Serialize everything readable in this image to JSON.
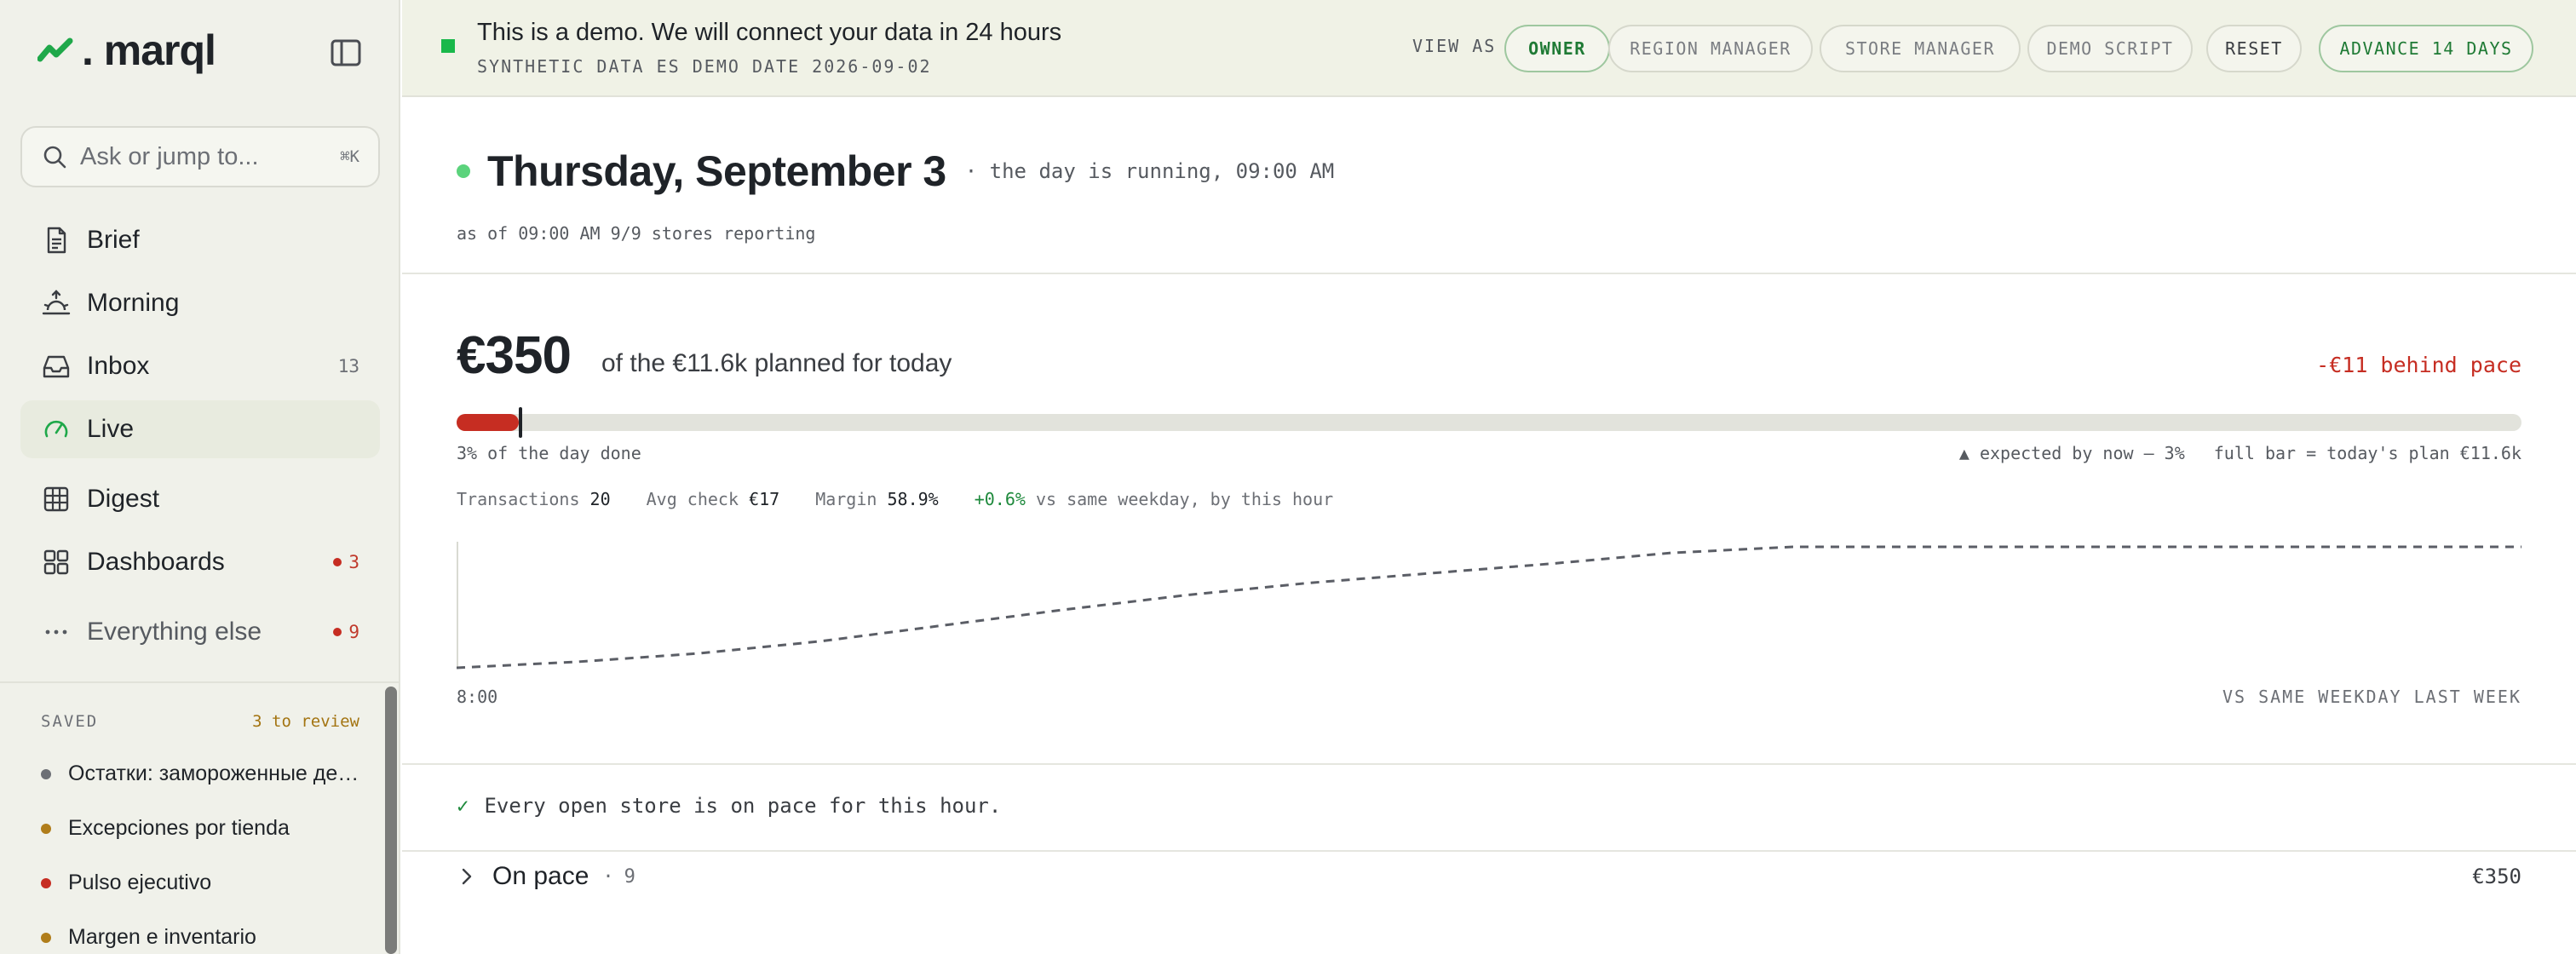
{
  "app": {
    "logo_text": ". marql"
  },
  "search": {
    "placeholder": "Ask or jump to...",
    "shortcut": "⌘K"
  },
  "nav": {
    "brief": "Brief",
    "morning": "Morning",
    "inbox": {
      "label": "Inbox",
      "count": "13"
    },
    "live": "Live",
    "digest": "Digest",
    "dashboards": {
      "label": "Dashboards",
      "badge": "3"
    },
    "everything_else": {
      "label": "Everything else",
      "badge": "9"
    }
  },
  "saved": {
    "title": "SAVED",
    "review": "3 to review",
    "items": [
      {
        "label": "Остатки: замороженные ден...",
        "color": "#6c6f75"
      },
      {
        "label": "Excepciones por tienda",
        "color": "#b07d1a"
      },
      {
        "label": "Pulso ejecutivo",
        "color": "#c62d22"
      },
      {
        "label": "Margen e inventario",
        "color": "#b07d1a"
      }
    ]
  },
  "banner": {
    "message": "This is a demo. We will connect your data in 24 hours",
    "meta": "SYNTHETIC DATA  ES  DEMO DATE 2026-09-02",
    "view_as": "VIEW AS",
    "buttons": {
      "owner": "OWNER",
      "region_manager": "REGION MANAGER",
      "store_manager": "STORE MANAGER",
      "demo_script": "DEMO SCRIPT",
      "reset": "RESET",
      "advance": "ADVANCE 14 DAYS"
    },
    "selected_view": "OWNER"
  },
  "day": {
    "title": "Thursday, September 3",
    "status": "· the day is running, 09:00 AM",
    "as_of": "as of 09:00 AM  9/9 stores reporting"
  },
  "pace": {
    "amount": "€350",
    "planned": "of the €11.6k planned for today",
    "behind": "-€11 behind pace",
    "progress_fraction": 0.03,
    "expected_fraction": 0.03,
    "done_label": "3% of the day done",
    "expected_label": "▲ expected by now — 3%",
    "full_bar_label": "full bar = today's plan €11.6k"
  },
  "stats": {
    "transactions_label": "Transactions",
    "transactions_value": "20",
    "avg_check_label": "Avg check",
    "avg_check_value": "€17",
    "margin_label": "Margin",
    "margin_value": "58.9%",
    "delta_value": "+0.6%",
    "delta_label": "vs same weekday, by this hour"
  },
  "chart_data": {
    "type": "line",
    "series": [
      {
        "values": [
          0.0,
          0.05,
          0.12,
          0.22,
          0.35,
          0.48,
          0.6,
          0.7,
          0.78,
          0.86,
          0.95,
          1.0,
          1.0,
          1.0,
          1.0,
          1.0,
          1.0,
          1.0
        ],
        "style": "dashed",
        "color": "#5b5e66"
      }
    ],
    "x_start_label": "8:00",
    "caption": "VS SAME WEEKDAY LAST WEEK"
  },
  "status_line": {
    "check": "✓",
    "text": "Every open store is on pace for this hour."
  },
  "group": {
    "name": "On pace",
    "separator": "·",
    "count": "9",
    "amount": "€350"
  }
}
